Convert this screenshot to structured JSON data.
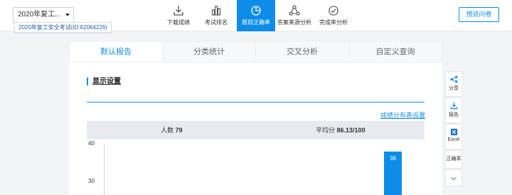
{
  "header": {
    "survey_select": "2020年复工...",
    "survey_tooltip": "2020年复工安全考试(ID:62064226)",
    "preview_button": "预览问卷"
  },
  "toolbar": [
    {
      "label": "下载成绩",
      "icon": "download-icon",
      "active": false
    },
    {
      "label": "考试排名",
      "icon": "bar-chart-icon",
      "active": false
    },
    {
      "label": "题目正确率",
      "icon": "pie-chart-icon",
      "active": true
    },
    {
      "label": "答案来源分析",
      "icon": "share-nodes-icon",
      "active": false
    },
    {
      "label": "完成率分析",
      "icon": "check-circle-icon",
      "active": false
    }
  ],
  "tabs": [
    {
      "label": "默认报告",
      "active": true
    },
    {
      "label": "分类统计",
      "active": false
    },
    {
      "label": "交叉分析",
      "active": false
    },
    {
      "label": "自定义查询",
      "active": false
    }
  ],
  "panel": {
    "section_title": "显示设置",
    "dist_link": "成绩分布表设置",
    "count_label": "人数",
    "count_value": "79",
    "avg_label": "平均分",
    "avg_value": "86.13/100"
  },
  "chart_data": {
    "type": "bar",
    "y_ticks": [
      "40",
      "30"
    ],
    "ylim_visible": [
      27,
      40
    ],
    "bars": [
      {
        "value": 38,
        "label": "38"
      }
    ],
    "color": "#0c8dea"
  },
  "side_tools": [
    {
      "label": "分享",
      "icon": "share-icon"
    },
    {
      "label": "报告",
      "icon": "download-report-icon"
    },
    {
      "label": "Excel",
      "icon": "excel-icon"
    },
    {
      "label": "正确率",
      "icon": ""
    }
  ]
}
